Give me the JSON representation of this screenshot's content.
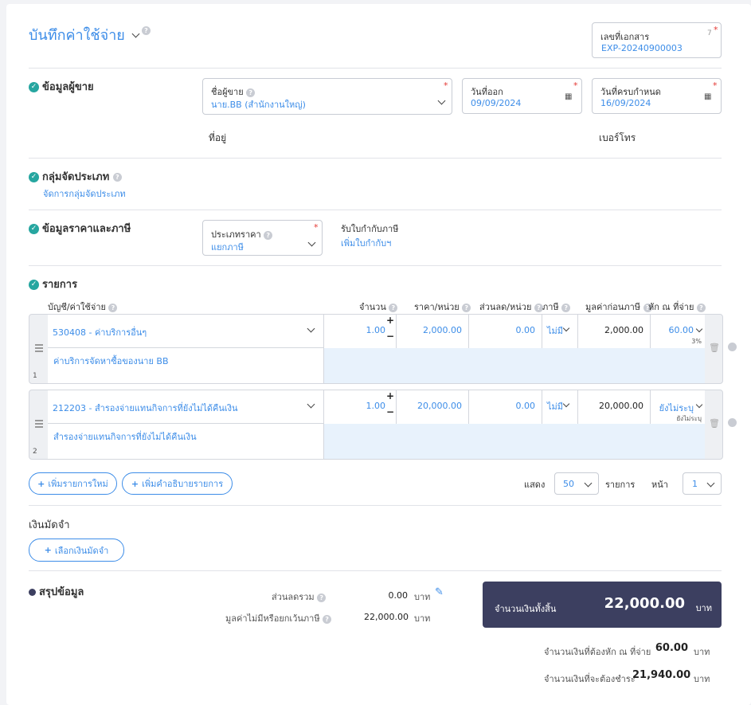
{
  "header": {
    "title": "บันทึกค่าใช้จ่าย",
    "doc_number_label": "เลขที่เอกสาร",
    "doc_number_hint": "7",
    "doc_number_value": "EXP-20240900003"
  },
  "vendor": {
    "section_title": "ข้อมูลผู้ขาย",
    "name_label": "ชื่อผู้ขาย",
    "name_value": "นาย.BB (สำนักงานใหญ่)",
    "issue_date_label": "วันที่ออก",
    "issue_date_value": "09/09/2024",
    "due_date_label": "วันที่ครบกำหนด",
    "due_date_value": "16/09/2024",
    "address_label": "ที่อยู่",
    "phone_label": "เบอร์โทร"
  },
  "category": {
    "section_title": "กลุ่มจัดประเภท",
    "manage_link": "จัดการกลุ่มจัดประเภท"
  },
  "pricing": {
    "section_title": "ข้อมูลราคาและภาษี",
    "price_type_label": "ประเภทราคา",
    "price_type_value": "แยกภาษี",
    "tax_invoice_label": "รับใบกำกับภาษี",
    "tax_invoice_link": "เพิ่มใบกำกับฯ"
  },
  "items": {
    "section_title": "รายการ",
    "columns": {
      "account": "บัญชี/ค่าใช้จ่าย",
      "qty": "จำนวน",
      "unit_price": "ราคา/หน่วย",
      "discount": "ส่วนลด/หน่วย",
      "tax": "ภาษี",
      "pre_tax": "มูลค่าก่อนภาษี",
      "withholding": "หัก ณ ที่จ่าย"
    },
    "rows": [
      {
        "index": "1",
        "account": "530408 - ค่าบริการอื่นๆ",
        "description": "ค่าบริการจัดหาซื้อของนาย BB",
        "qty": "1.00",
        "unit_price": "2,000.00",
        "discount": "0.00",
        "tax": "ไม่มี",
        "pre_tax": "2,000.00",
        "withholding": "60.00",
        "withholding_note": "3%"
      },
      {
        "index": "2",
        "account": "212203 - สำรองจ่ายแทนกิจการที่ยังไม่ได้คืนเงิน",
        "description": "สำรองจ่ายแทนกิจการที่ยังไม่ได้คืนเงิน",
        "qty": "1.00",
        "unit_price": "20,000.00",
        "discount": "0.00",
        "tax": "ไม่มี",
        "pre_tax": "20,000.00",
        "withholding": "ยังไม่ระบุ",
        "withholding_note": "ยังไม่ระบุ"
      }
    ],
    "add_row_button": "เพิ่มรายการใหม่",
    "add_desc_button": "เพิ่มคำอธิบายรายการ",
    "show_label": "แสดง",
    "page_size": "50",
    "items_label": "รายการ",
    "page_label": "หน้า",
    "page_number": "1"
  },
  "deposit": {
    "section_title": "เงินมัดจำ",
    "select_button": "เลือกเงินมัดจำ"
  },
  "summary": {
    "section_title": "สรุปข้อมูล",
    "discount_label": "ส่วนลดรวม",
    "discount_value": "0.00",
    "non_taxable_label": "มูลค่าไม่มีหรือยกเว้นภาษี",
    "non_taxable_value": "22,000.00",
    "currency": "บาท",
    "total_label": "จำนวนเงินทั้งสิ้น",
    "total_value": "22,000.00",
    "withholding_label": "จำนวนเงินที่ต้องหัก ณ ที่จ่าย",
    "withholding_value": "60.00",
    "payable_label": "จำนวนเงินที่จะต้องชำระ",
    "payable_value": "21,940.00"
  },
  "colors": {
    "accent": "#3d8de8",
    "check": "#26a6a0",
    "dark_panel": "#3c3f60",
    "required": "#e53935"
  }
}
